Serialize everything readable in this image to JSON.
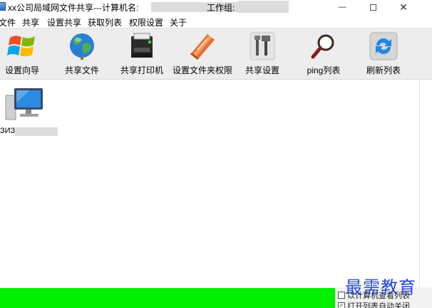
{
  "window": {
    "title_prefix": "xx公司局域网文件共享---计算机名:",
    "title_workgroup_label": "工作组:",
    "min_glyph": "—",
    "close_glyph": "✕"
  },
  "menu": [
    {
      "label": "文件"
    },
    {
      "label": "共享"
    },
    {
      "label": "设置共享"
    },
    {
      "label": "获取列表"
    },
    {
      "label": "权限设置"
    },
    {
      "label": "关于"
    }
  ],
  "toolbar": [
    {
      "label": "设置向导",
      "icon": "windows-logo-icon"
    },
    {
      "label": "共享文件",
      "icon": "globe-icon"
    },
    {
      "label": "共享打印机",
      "icon": "printer-icon"
    },
    {
      "label": "设置文件夹权限",
      "icon": "folder-book-icon"
    },
    {
      "label": "共享设置",
      "icon": "tools-icon"
    },
    {
      "label": "ping列表",
      "icon": "magnifier-icon"
    },
    {
      "label": "刷新列表",
      "icon": "refresh-icon"
    }
  ],
  "computers": [
    {
      "label_prefix": "ЗИЗ-",
      "icon": "computer-monitor-icon"
    }
  ],
  "status": {
    "option1_label": "以计算机查看列表",
    "option2_label": "打开列表自动关闭",
    "option2_checked": true
  },
  "watermark": "最需教育",
  "colors": {
    "status_green": "#00f000",
    "toolbar_bg": "#ededed",
    "watermark": "#1a3bd6"
  }
}
